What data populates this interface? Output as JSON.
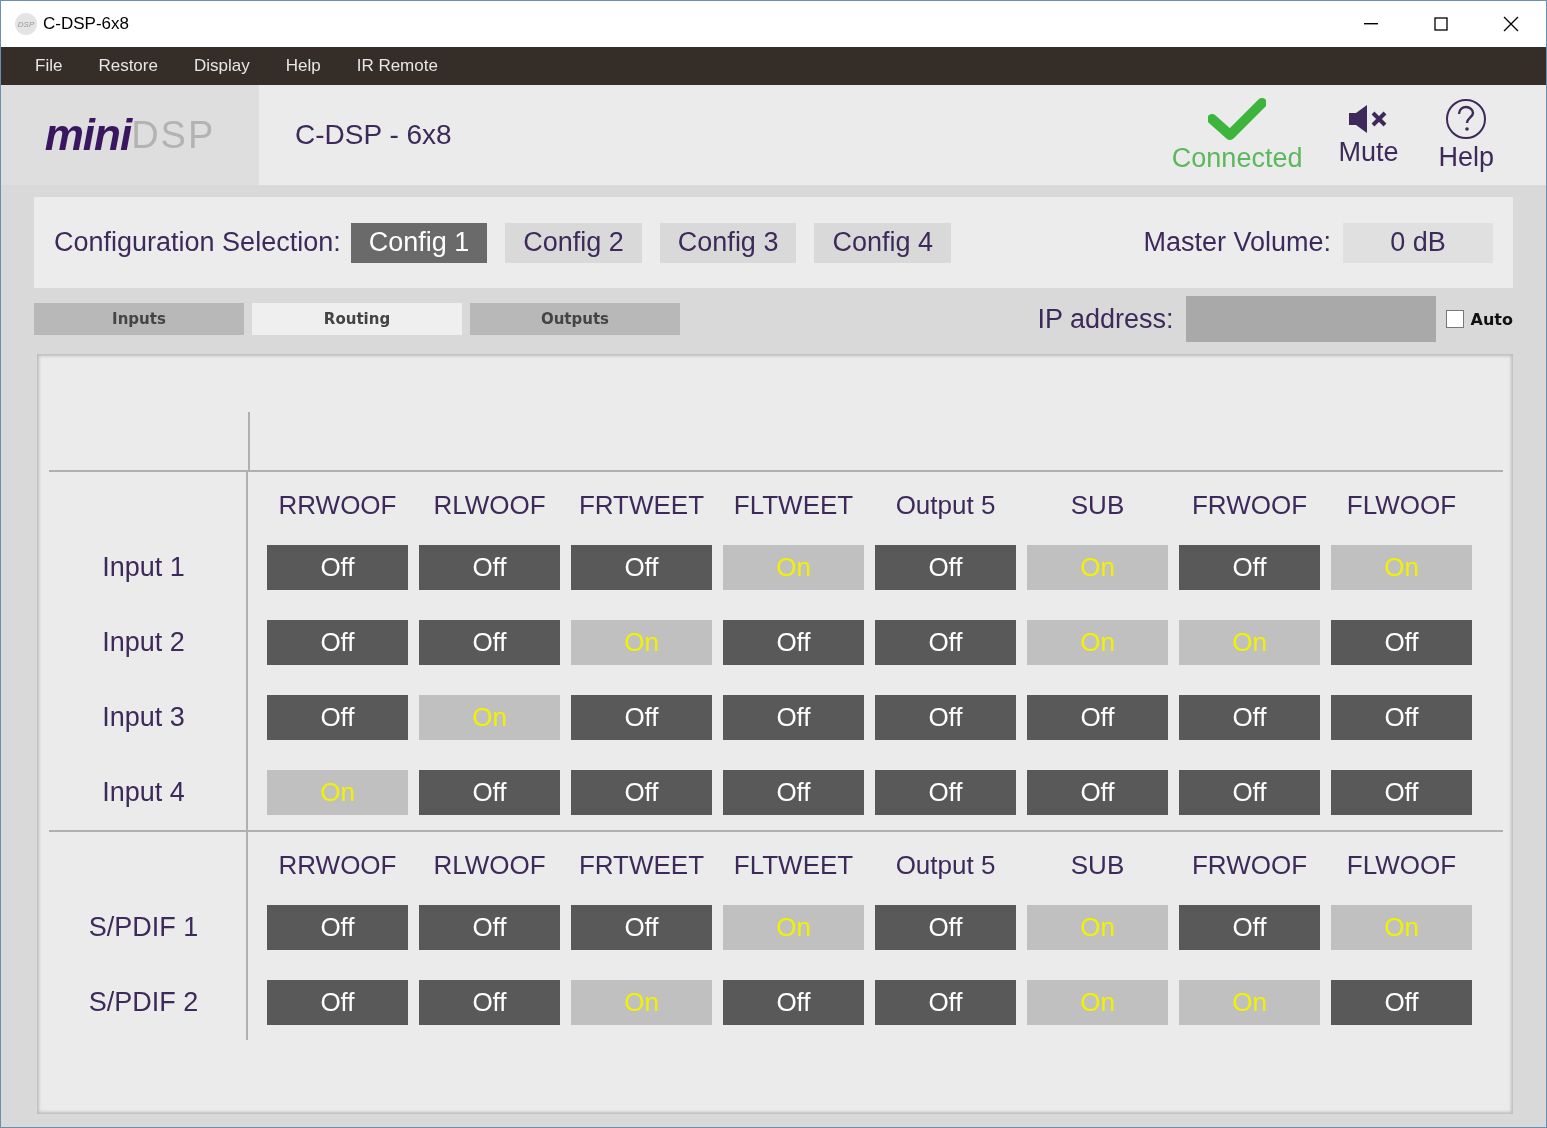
{
  "window": {
    "icon_text": "DSP",
    "title": "C-DSP-6x8"
  },
  "menu": [
    "File",
    "Restore",
    "Display",
    "Help",
    "IR Remote"
  ],
  "header": {
    "logo_main": "mini",
    "logo_suffix": "DSP",
    "device": "C-DSP - 6x8",
    "status": "Connected",
    "mute": "Mute",
    "help": "Help"
  },
  "config": {
    "label": "Configuration Selection:",
    "options": [
      {
        "label": "Config 1",
        "selected": true
      },
      {
        "label": "Config 2",
        "selected": false
      },
      {
        "label": "Config 3",
        "selected": false
      },
      {
        "label": "Config 4",
        "selected": false
      }
    ],
    "volume_label": "Master Volume:",
    "volume": "0 dB"
  },
  "tabs": [
    {
      "label": "Inputs",
      "selected": false
    },
    {
      "label": "Routing",
      "selected": true
    },
    {
      "label": "Outputs",
      "selected": false
    }
  ],
  "ip": {
    "label": "IP address:",
    "auto_label": "Auto",
    "auto_checked": false
  },
  "routing": [
    {
      "outputs": [
        "RRWOOF",
        "RLWOOF",
        "FRTWEET",
        "FLTWEET",
        "Output 5",
        "SUB",
        "FRWOOF",
        "FLWOOF"
      ],
      "rows": [
        {
          "label": "Input 1",
          "cells": [
            {
              "label": "Off",
              "on": false
            },
            {
              "label": "Off",
              "on": false
            },
            {
              "label": "Off",
              "on": false
            },
            {
              "label": "On",
              "on": true
            },
            {
              "label": "Off",
              "on": false
            },
            {
              "label": "On",
              "on": true
            },
            {
              "label": "Off",
              "on": false
            },
            {
              "label": "On",
              "on": true
            }
          ]
        },
        {
          "label": "Input 2",
          "cells": [
            {
              "label": "Off",
              "on": false
            },
            {
              "label": "Off",
              "on": false
            },
            {
              "label": "On",
              "on": true
            },
            {
              "label": "Off",
              "on": false
            },
            {
              "label": "Off",
              "on": false
            },
            {
              "label": "On",
              "on": true
            },
            {
              "label": "On",
              "on": true
            },
            {
              "label": "Off",
              "on": false
            }
          ]
        },
        {
          "label": "Input 3",
          "cells": [
            {
              "label": "Off",
              "on": false
            },
            {
              "label": "On",
              "on": true
            },
            {
              "label": "Off",
              "on": false
            },
            {
              "label": "Off",
              "on": false
            },
            {
              "label": "Off",
              "on": false
            },
            {
              "label": "Off",
              "on": false
            },
            {
              "label": "Off",
              "on": false
            },
            {
              "label": "Off",
              "on": false
            }
          ]
        },
        {
          "label": "Input 4",
          "cells": [
            {
              "label": "On",
              "on": true
            },
            {
              "label": "Off",
              "on": false
            },
            {
              "label": "Off",
              "on": false
            },
            {
              "label": "Off",
              "on": false
            },
            {
              "label": "Off",
              "on": false
            },
            {
              "label": "Off",
              "on": false
            },
            {
              "label": "Off",
              "on": false
            },
            {
              "label": "Off",
              "on": false
            }
          ]
        }
      ]
    },
    {
      "outputs": [
        "RRWOOF",
        "RLWOOF",
        "FRTWEET",
        "FLTWEET",
        "Output 5",
        "SUB",
        "FRWOOF",
        "FLWOOF"
      ],
      "rows": [
        {
          "label": "S/PDIF 1",
          "cells": [
            {
              "label": "Off",
              "on": false
            },
            {
              "label": "Off",
              "on": false
            },
            {
              "label": "Off",
              "on": false
            },
            {
              "label": "On",
              "on": true
            },
            {
              "label": "Off",
              "on": false
            },
            {
              "label": "On",
              "on": true
            },
            {
              "label": "Off",
              "on": false
            },
            {
              "label": "On",
              "on": true
            }
          ]
        },
        {
          "label": "S/PDIF 2",
          "cells": [
            {
              "label": "Off",
              "on": false
            },
            {
              "label": "Off",
              "on": false
            },
            {
              "label": "On",
              "on": true
            },
            {
              "label": "Off",
              "on": false
            },
            {
              "label": "Off",
              "on": false
            },
            {
              "label": "On",
              "on": true
            },
            {
              "label": "On",
              "on": true
            },
            {
              "label": "Off",
              "on": false
            }
          ]
        }
      ]
    }
  ]
}
